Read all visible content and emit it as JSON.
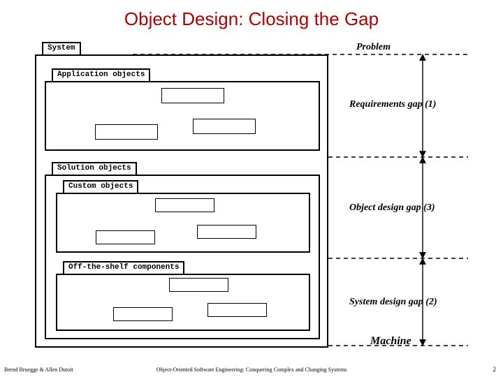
{
  "title": "Object Design: Closing the Gap",
  "folders": {
    "system": "System",
    "application": "Application objects",
    "solution": "Solution objects",
    "custom": "Custom objects",
    "offshelf": "Off-the-shelf components"
  },
  "labels": {
    "problem": "Problem",
    "req_gap": "Requirements gap (1)",
    "obj_gap": "Object design gap (3)",
    "sys_gap": "System design gap (2)",
    "machine": "Machine"
  },
  "footer": {
    "authors": "Bernd Bruegge & Allen Dutoit",
    "book": "Object-Oriented Software Engineering: Conquering Complex and Changing Systems",
    "page": "2"
  }
}
